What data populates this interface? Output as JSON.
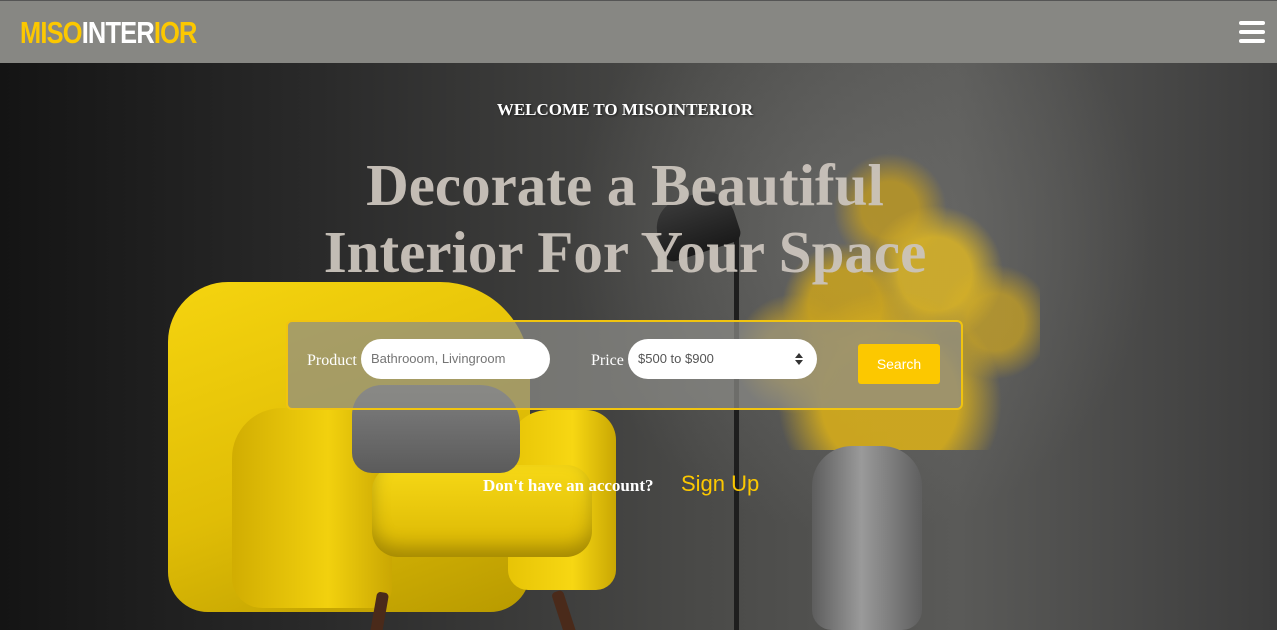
{
  "header": {
    "logo_parts": [
      "MISO",
      "INTER",
      "IOR"
    ],
    "menu_icon": "hamburger-menu-icon"
  },
  "hero": {
    "welcome": "WELCOME TO MISOINTERIOR",
    "headline_line1": "Decorate a Beautiful",
    "headline_line2": "Interior For Your Space"
  },
  "search": {
    "product_label": "Product",
    "product_placeholder": "Bathrooom, Livingroom",
    "price_label": "Price",
    "price_value": "$500 to $900",
    "button_label": "Search"
  },
  "account": {
    "prompt": "Don't have an account?",
    "signup_label": "Sign Up"
  },
  "colors": {
    "accent": "#fcc800",
    "header_bg": "#878783"
  }
}
